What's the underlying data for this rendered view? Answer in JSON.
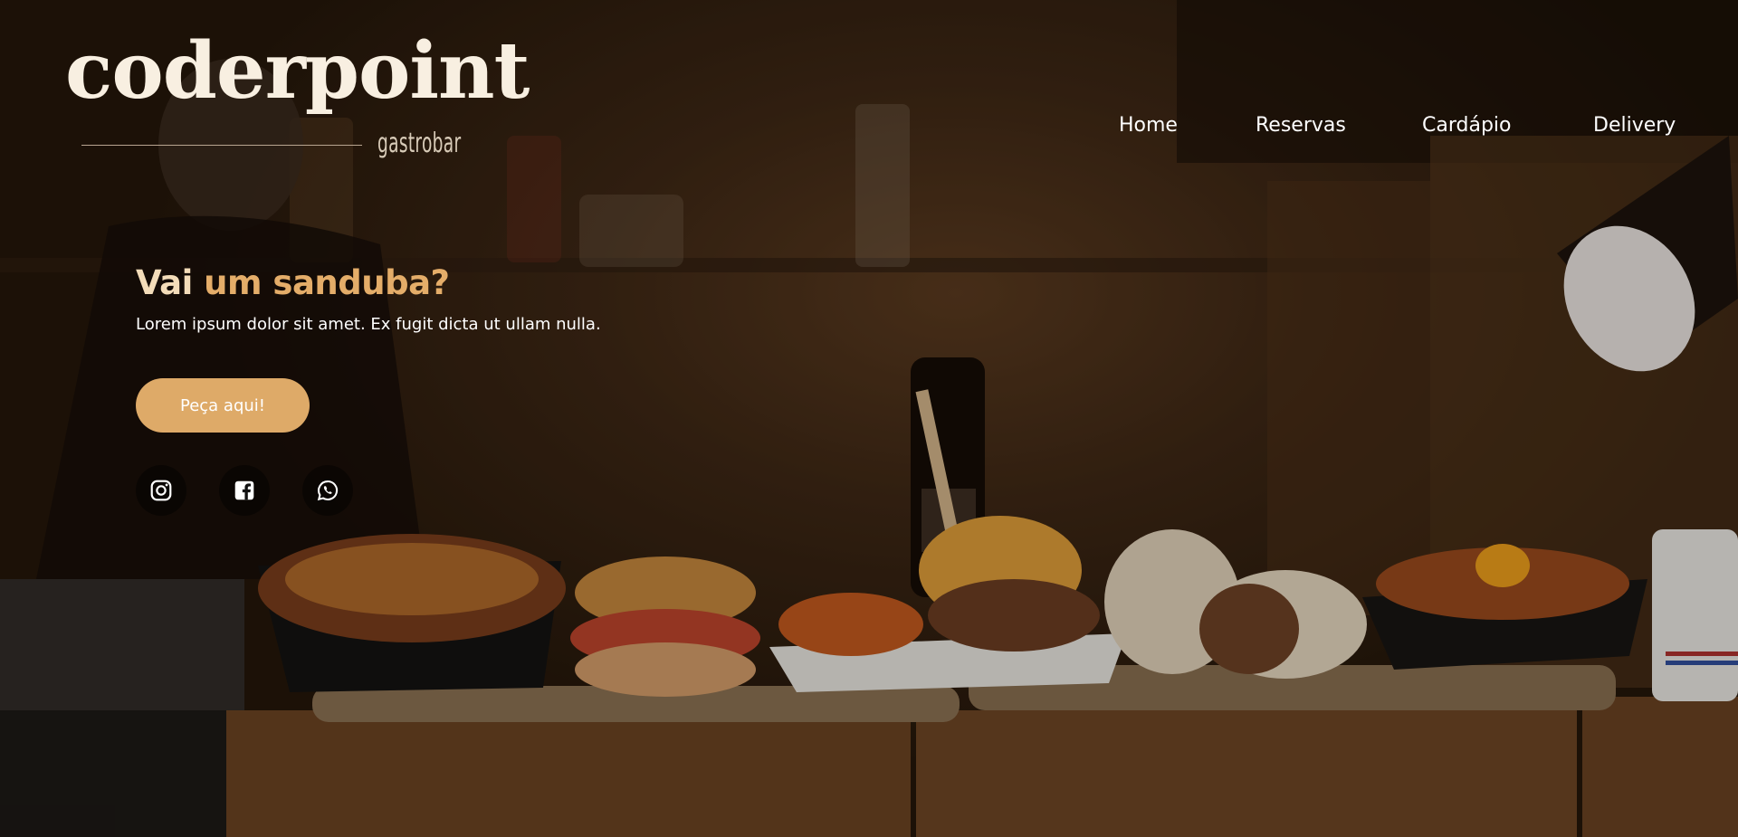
{
  "brand": {
    "name": "coderpoint",
    "tagline": "gastrobar"
  },
  "nav": {
    "items": [
      {
        "label": "Home"
      },
      {
        "label": "Reservas"
      },
      {
        "label": "Cardápio"
      },
      {
        "label": "Delivery"
      }
    ]
  },
  "hero": {
    "headline_part1": "Vai",
    "headline_part2": "um sanduba?",
    "lede": "Lorem ipsum dolor sit amet. Ex fugit dicta ut ullam nulla.",
    "cta_label": "Peça aqui!",
    "background_image": "hero-photo-food-on-wooden-crates"
  },
  "social": {
    "icons": [
      "instagram-icon",
      "facebook-icon",
      "whatsapp-icon"
    ]
  },
  "colors": {
    "accent": "#deaa68",
    "headline_light": "#f3dcb9",
    "headline_accent": "#e4ad69",
    "logo": "#f8efe1",
    "nav_text": "#ffffff",
    "social_bg": "#000000"
  }
}
